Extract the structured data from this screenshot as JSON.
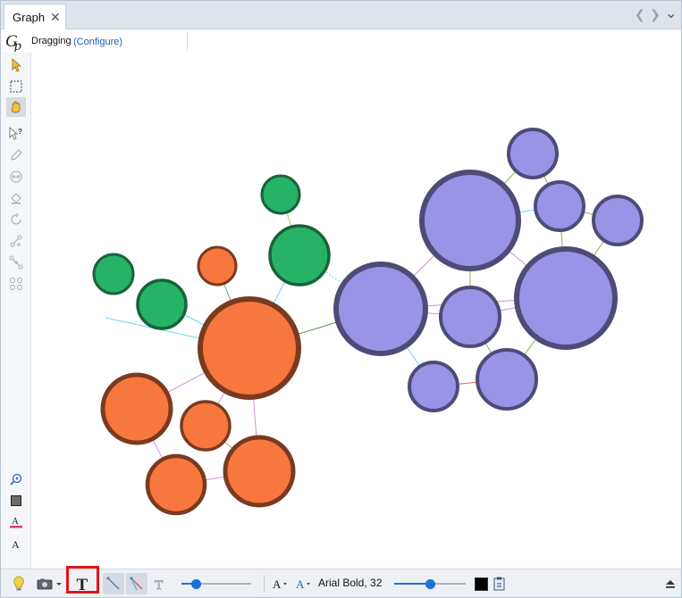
{
  "tab": {
    "title": "Graph",
    "close_glyph": "✕",
    "prev_glyph": "❮",
    "next_glyph": "❯",
    "menu_glyph": "⌄"
  },
  "toolbar": {
    "mode_label": "Dragging",
    "configure_label": "(Configure)"
  },
  "left_tools": [
    {
      "name": "select-arrow-icon",
      "active": false
    },
    {
      "name": "rectangle-select-icon",
      "active": false
    },
    {
      "name": "drag-hand-icon",
      "active": true
    },
    {
      "name": "edit-query-icon",
      "active": false
    },
    {
      "name": "pencil-icon",
      "active": false
    },
    {
      "name": "resize-icon",
      "active": false
    },
    {
      "name": "paint-bucket-icon",
      "active": false
    },
    {
      "name": "rotate-icon",
      "active": false
    },
    {
      "name": "add-edge-icon",
      "active": false
    },
    {
      "name": "shortest-path-icon",
      "active": false
    },
    {
      "name": "heat-graph-icon",
      "active": false
    }
  ],
  "left_tools_bottom": [
    {
      "name": "zoom-fit-icon"
    },
    {
      "name": "node-color-icon"
    },
    {
      "name": "label-color-icon"
    },
    {
      "name": "label-size-icon"
    }
  ],
  "bottom_toolbar": {
    "font_label": "Arial Bold, 32",
    "size_slider_value": 0.2,
    "font_slider_value": 0.5,
    "label_color": "#000000"
  },
  "graph": {
    "colors": {
      "green_fill": "#26b267",
      "green_stroke": "#18623a",
      "orange_fill": "#f7773f",
      "orange_stroke": "#7a3a20",
      "purple_fill": "#9a94e6",
      "purple_stroke": "#4f4b78"
    }
  }
}
